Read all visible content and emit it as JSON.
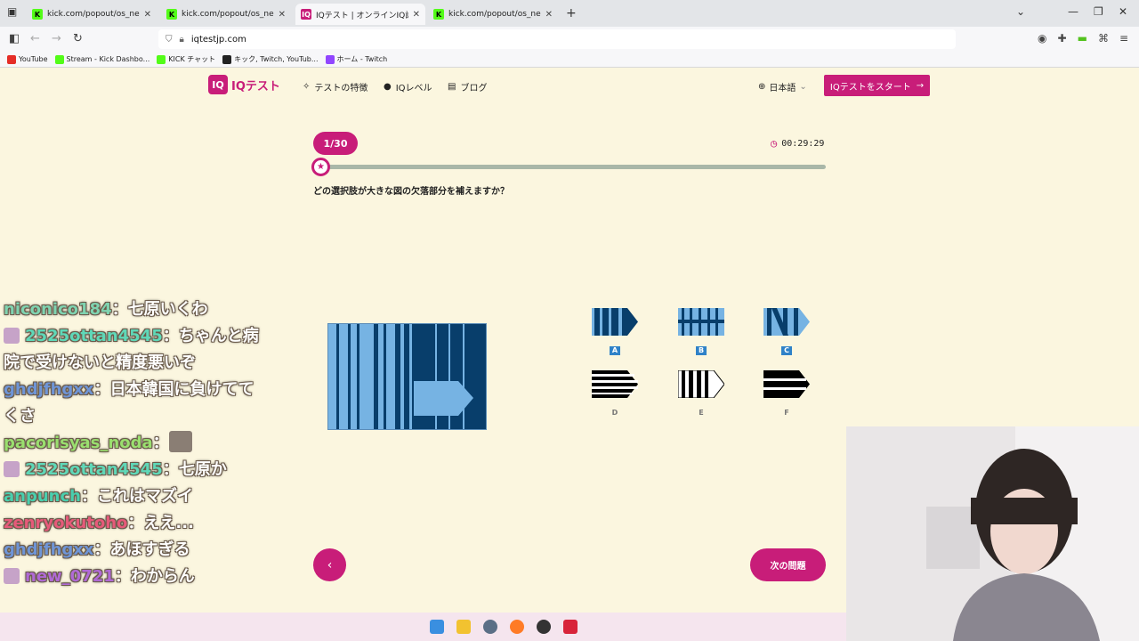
{
  "browser": {
    "tabs": [
      {
        "label": "kick.com/popout/os_new/chat",
        "icon": "kick-icon",
        "active": false
      },
      {
        "label": "kick.com/popout/os_new/chat",
        "icon": "kick-icon",
        "active": false
      },
      {
        "label": "IQテスト | オンラインIQ診断・知能",
        "icon": "iq-icon",
        "active": true
      },
      {
        "label": "kick.com/popout/os_new/chat",
        "icon": "kick-icon",
        "active": false
      }
    ],
    "url": "iqtestjp.com",
    "bookmarks": [
      {
        "label": "YouTube",
        "color": "#e52d27"
      },
      {
        "label": "Stream - Kick Dashbo...",
        "color": "#53fc18"
      },
      {
        "label": "KICK チャット",
        "color": "#53fc18"
      },
      {
        "label": "キック, Twitch, YouTub...",
        "color": "#222222"
      },
      {
        "label": "ホーム - Twitch",
        "color": "#9146ff"
      }
    ]
  },
  "site": {
    "logo_box": "IQ",
    "logo_text": "IQテスト",
    "nav": [
      {
        "label": "テストの特徴",
        "icon": "sparkle-icon"
      },
      {
        "label": "IQレベル",
        "icon": "pin-icon"
      },
      {
        "label": "ブログ",
        "icon": "book-icon"
      }
    ],
    "language": "日本語",
    "cta": "IQテストをスタート",
    "accent": "#c81d79"
  },
  "quiz": {
    "counter": "1/30",
    "timer": "00:29:29",
    "progress": 0.0333,
    "question": "どの選択肢が大きな図の欠落部分を補えますか？",
    "options": [
      "A",
      "B",
      "C",
      "D",
      "E",
      "F"
    ],
    "next_label": "次の問題",
    "prev_label": "‹"
  },
  "chat": [
    {
      "user": "niconico184",
      "message": "七原いくわ",
      "color": "#7fd3b0",
      "avatar": false
    },
    {
      "user": "2525ottan4545",
      "message": "ちゃんと病院で受けないと精度悪いぞ",
      "color": "#5fd8b8",
      "avatar": true
    },
    {
      "user": "ghdjfhgxx",
      "message": "日本韓国に負けててくさ",
      "color": "#6f95d6",
      "avatar": false
    },
    {
      "user": "pacorisyas_noda",
      "message": "",
      "color": "#9adf6f",
      "avatar": false,
      "emote": true
    },
    {
      "user": "2525ottan4545",
      "message": "七原か",
      "color": "#5fd8b8",
      "avatar": true
    },
    {
      "user": "anpunch",
      "message": "これはマズイ",
      "color": "#49cfae",
      "avatar": false
    },
    {
      "user": "zenryokutoho",
      "message": "ええ...",
      "color": "#e65a7a",
      "avatar": false
    },
    {
      "user": "ghdjfhgxx",
      "message": "あほすぎる",
      "color": "#6f95d6",
      "avatar": false
    },
    {
      "user": "new_0721",
      "message": "わからん",
      "color": "#b06ad6",
      "avatar": true
    }
  ]
}
